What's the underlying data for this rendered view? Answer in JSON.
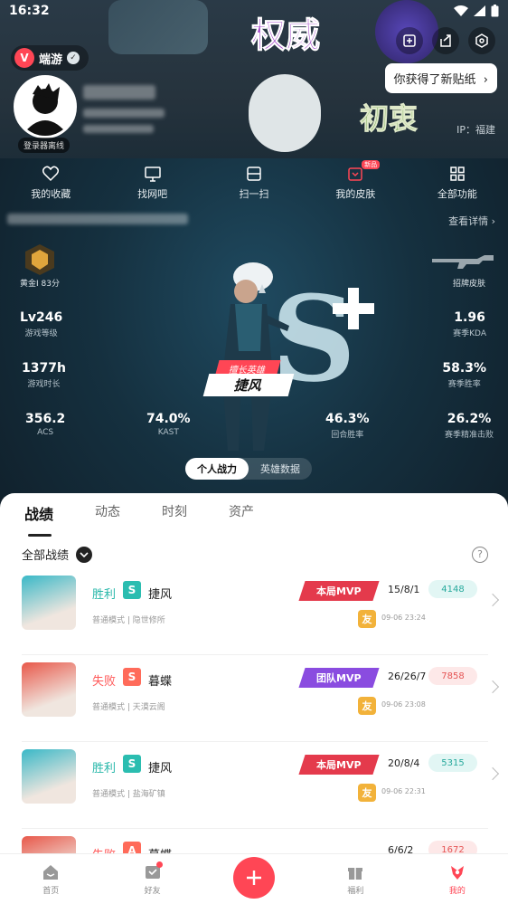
{
  "status_bar": {
    "time": "16:32"
  },
  "app": {
    "name": "端游"
  },
  "sticker_tip": "你获得了新贴纸",
  "profile": {
    "online_status": "登录器离线",
    "ip": "IP：福建"
  },
  "quick_nav": [
    {
      "label": "我的收藏",
      "icon": "heart-icon"
    },
    {
      "label": "找网吧",
      "icon": "monitor-icon"
    },
    {
      "label": "扫一扫",
      "icon": "scan-icon"
    },
    {
      "label": "我的皮肤",
      "icon": "skin-icon",
      "badge": "新品"
    },
    {
      "label": "全部功能",
      "icon": "grid-icon"
    }
  ],
  "details_link": "查看详情",
  "stats": {
    "rank_label": "黄金I 83分",
    "skin_label": "招牌皮肤",
    "level": {
      "value": "Lv246",
      "label": "游戏等级"
    },
    "kda": {
      "value": "1.96",
      "label": "赛季KDA"
    },
    "play_time": {
      "value": "1377h",
      "label": "游戏时长"
    },
    "win_rate": {
      "value": "58.3%",
      "label": "赛季胜率"
    },
    "acs": {
      "value": "356.2",
      "label": "ACS"
    },
    "kast": {
      "value": "74.0%",
      "label": "KAST"
    },
    "round_win": {
      "value": "46.3%",
      "label": "回合胜率"
    },
    "headshot": {
      "value": "26.2%",
      "label": "赛季精准击败"
    }
  },
  "best_hero": {
    "tag": "擅长英雄",
    "name": "捷风",
    "grade": "S"
  },
  "toggle": {
    "active": "个人战力",
    "inactive": "英雄数据"
  },
  "tabs": [
    "战绩",
    "动态",
    "时刻",
    "资产"
  ],
  "filter_label": "全部战绩",
  "matches": [
    {
      "result": "胜利",
      "result_color": "#27b7a9",
      "rank": "S",
      "rank_color": "#2bbdb0",
      "hero": "捷风",
      "mode": "普通模式 | 隐世修所",
      "mvp": "本局MVP",
      "mvp_color": "#e43a4c",
      "kda": "15/8/1",
      "score": "4148",
      "score_bg": "#e2f6f4",
      "score_color": "#27a99c",
      "friend": "友",
      "time": "09-06 23:24",
      "avatar_color": "#39b8c7"
    },
    {
      "result": "失败",
      "result_color": "#ff5a5a",
      "rank": "S",
      "rank_color": "#ff6b5a",
      "hero": "暮蝶",
      "mode": "普通模式 | 天漠云阁",
      "mvp": "团队MVP",
      "mvp_color": "#8a4ce0",
      "kda": "26/26/7",
      "score": "7858",
      "score_bg": "#fde8e8",
      "score_color": "#e55454",
      "friend": "友",
      "time": "09-06 23:08",
      "avatar_color": "#e8584a"
    },
    {
      "result": "胜利",
      "result_color": "#27b7a9",
      "rank": "S",
      "rank_color": "#2bbdb0",
      "hero": "捷风",
      "mode": "普通模式 | 盐海矿镇",
      "mvp": "本局MVP",
      "mvp_color": "#e43a4c",
      "kda": "20/8/4",
      "score": "5315",
      "score_bg": "#e2f6f4",
      "score_color": "#27a99c",
      "friend": "友",
      "time": "09-06 22:31",
      "avatar_color": "#39b8c7"
    },
    {
      "result": "失败",
      "result_color": "#ff5a5a",
      "rank": "A",
      "rank_color": "#ff6b5a",
      "hero": "暮蝶",
      "kda": "6/6/2",
      "score": "1672",
      "score_bg": "#fde8e8",
      "score_color": "#e55454",
      "avatar_color": "#e8584a"
    }
  ],
  "bottom_nav": [
    {
      "label": "首页",
      "icon": "home-icon"
    },
    {
      "label": "好友",
      "icon": "friends-icon"
    },
    {
      "label": "福利",
      "icon": "gift-icon"
    },
    {
      "label": "我的",
      "icon": "me-icon"
    }
  ]
}
